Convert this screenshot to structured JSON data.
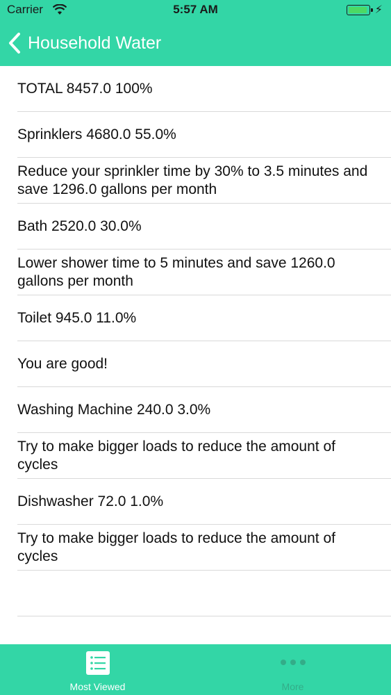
{
  "status_bar": {
    "carrier": "Carrier",
    "time": "5:57 AM",
    "battery_icon": "battery-charging-icon"
  },
  "nav": {
    "back_icon": "chevron-left-icon",
    "title": "Household Water"
  },
  "rows": [
    "TOTAL 8457.0   100%",
    "Sprinklers 4680.0   55.0%",
    "Reduce your sprinkler time by 30% to 3.5 minutes and save 1296.0 gallons per month",
    "Bath 2520.0   30.0%",
    "Lower shower time to 5 minutes and save 1260.0 gallons per month",
    "Toilet 945.0   11.0%",
    "You are good!",
    "Washing Machine 240.0   3.0%",
    "Try to make bigger loads to reduce the amount of cycles",
    "Dishwasher 72.0   1.0%",
    "Try to make bigger loads to reduce the amount of cycles",
    ""
  ],
  "tabbar": {
    "tabs": [
      {
        "label": "Most Viewed",
        "icon": "list-icon",
        "selected": true
      },
      {
        "label": "More",
        "icon": "more-icon",
        "selected": false
      }
    ]
  },
  "colors": {
    "accent": "#33d6a6",
    "separator": "#d9d9d9"
  }
}
